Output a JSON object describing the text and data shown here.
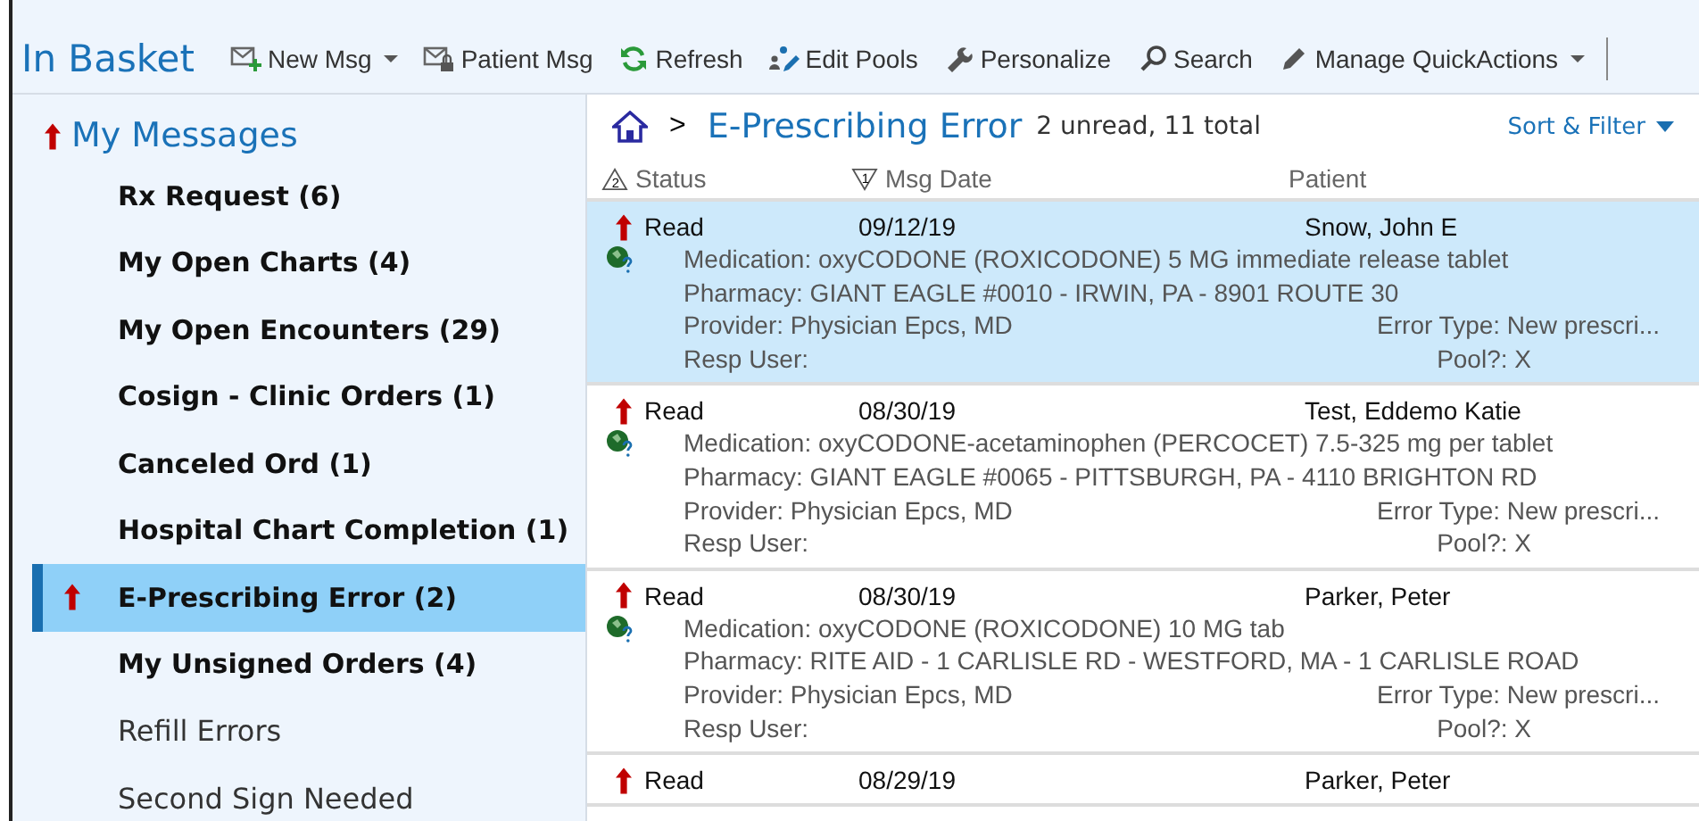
{
  "toolbar": {
    "title": "In Basket",
    "buttons": [
      {
        "kind": "new",
        "label": "New Msg",
        "dropdown": true
      },
      {
        "kind": "patient",
        "label": "Patient Msg",
        "dropdown": false
      },
      {
        "kind": "refresh",
        "label": "Refresh",
        "dropdown": false
      },
      {
        "kind": "pools",
        "label": "Edit Pools",
        "dropdown": false
      },
      {
        "kind": "personalize",
        "label": "Personalize",
        "dropdown": false
      },
      {
        "kind": "search",
        "label": "Search",
        "dropdown": false
      },
      {
        "kind": "quick",
        "label": "Manage QuickActions",
        "dropdown": true
      }
    ]
  },
  "sidebar": {
    "heading": "My Messages",
    "heading_priority": true,
    "items": [
      {
        "label": "Rx Request (6)",
        "unread": true,
        "priority": false,
        "selected": false
      },
      {
        "label": "My Open Charts (4)",
        "unread": true,
        "priority": false,
        "selected": false
      },
      {
        "label": "My Open Encounters (29)",
        "unread": true,
        "priority": false,
        "selected": false
      },
      {
        "label": "Cosign - Clinic Orders (1)",
        "unread": true,
        "priority": false,
        "selected": false
      },
      {
        "label": "Canceled Ord (1)",
        "unread": true,
        "priority": false,
        "selected": false
      },
      {
        "label": "Hospital Chart Completion (1)",
        "unread": true,
        "priority": false,
        "selected": false
      },
      {
        "label": "E-Prescribing Error (2)",
        "unread": true,
        "priority": true,
        "selected": true
      },
      {
        "label": "My Unsigned Orders (4)",
        "unread": true,
        "priority": false,
        "selected": false
      },
      {
        "label": "Refill Errors",
        "unread": false,
        "priority": false,
        "selected": false
      },
      {
        "label": "Second Sign Needed",
        "unread": false,
        "priority": false,
        "selected": false
      }
    ]
  },
  "pane": {
    "breadcrumb_separator": ">",
    "title": "E-Prescribing Error",
    "summary": "2 unread, 11 total",
    "sort_filter": "Sort & Filter",
    "columns": [
      {
        "label": "Status",
        "sort_rank": "2",
        "kind": "ascending"
      },
      {
        "label": "Msg Date",
        "sort_rank": "1",
        "kind": "descending"
      },
      {
        "label": "Patient",
        "kind": "plain"
      }
    ],
    "messages": [
      {
        "status": "Read",
        "date": "09/12/19",
        "patient": "Snow, John E",
        "priority": true,
        "selected": true,
        "medication": "Medication: oxyCODONE (ROXICODONE) 5 MG immediate release tablet",
        "pharmacy": "Pharmacy: GIANT EAGLE #0010 - IRWIN, PA - 8901 ROUTE 30",
        "provider": "Provider: Physician Epcs, MD",
        "error_type": "Error Type: New prescri...",
        "resp_user": "Resp User:",
        "pool": "Pool?: X"
      },
      {
        "status": "Read",
        "date": "08/30/19",
        "patient": "Test, Eddemo Katie",
        "priority": true,
        "selected": false,
        "medication": "Medication: oxyCODONE-acetaminophen (PERCOCET) 7.5-325 mg per tablet",
        "pharmacy": "Pharmacy: GIANT EAGLE #0065 - PITTSBURGH, PA - 4110 BRIGHTON RD",
        "provider": "Provider: Physician Epcs, MD",
        "error_type": "Error Type: New prescri...",
        "resp_user": "Resp User:",
        "pool": "Pool?: X"
      },
      {
        "status": "Read",
        "date": "08/30/19",
        "patient": "Parker, Peter",
        "priority": true,
        "selected": false,
        "medication": "Medication: oxyCODONE (ROXICODONE) 10 MG tab",
        "pharmacy": "Pharmacy: RITE AID - 1 CARLISLE RD - WESTFORD, MA - 1 CARLISLE ROAD",
        "provider": "Provider: Physician Epcs, MD",
        "error_type": "Error Type: New prescri...",
        "resp_user": "Resp User:",
        "pool": "Pool?: X"
      },
      {
        "status": "Read",
        "date": "08/29/19",
        "patient": "Parker, Peter",
        "priority": true,
        "selected": false
      }
    ]
  }
}
